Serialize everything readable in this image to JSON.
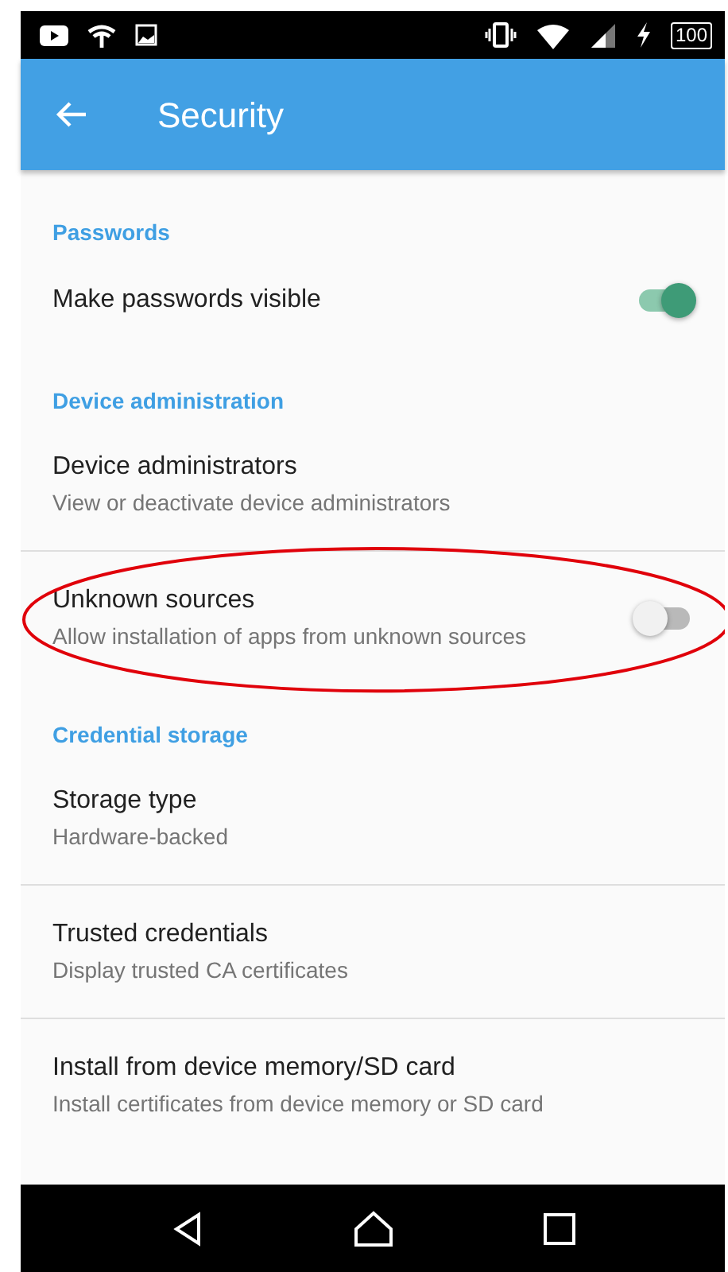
{
  "status_bar": {
    "battery": "100"
  },
  "app_bar": {
    "title": "Security"
  },
  "sections": [
    {
      "header": "Passwords",
      "items": [
        {
          "kind": "toggle",
          "title": "Make passwords visible",
          "on": true,
          "highlighted": false
        }
      ]
    },
    {
      "header": "Device administration",
      "items": [
        {
          "kind": "text",
          "title": "Device administrators",
          "summary": "View or deactivate device administrators",
          "highlighted": false
        },
        {
          "kind": "toggle",
          "title": "Unknown sources",
          "summary": "Allow installation of apps from unknown sources",
          "on": false,
          "highlighted": true
        }
      ]
    },
    {
      "header": "Credential storage",
      "items": [
        {
          "kind": "text",
          "title": "Storage type",
          "summary": "Hardware-backed",
          "highlighted": false
        },
        {
          "kind": "text",
          "title": "Trusted credentials",
          "summary": "Display trusted CA certificates",
          "highlighted": false
        },
        {
          "kind": "text",
          "title": "Install from device memory/SD card",
          "summary": "Install certificates from device memory or SD card",
          "highlighted": false
        }
      ]
    }
  ]
}
